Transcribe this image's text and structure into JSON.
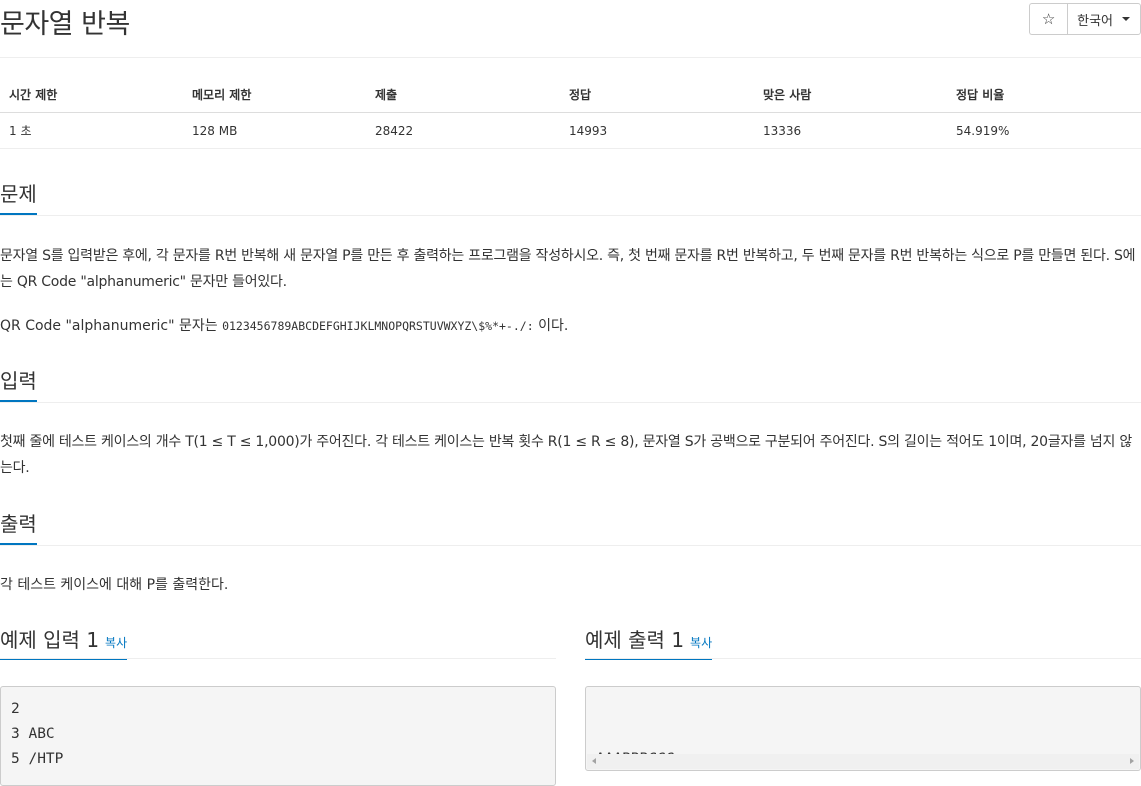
{
  "problem": {
    "title": "문자열 반복"
  },
  "top_actions": {
    "star": "☆",
    "language": "한국어"
  },
  "stats": {
    "headers": [
      "시간 제한",
      "메모리 제한",
      "제출",
      "정답",
      "맞은 사람",
      "정답 비율"
    ],
    "values": [
      "1 초",
      "128 MB",
      "28422",
      "14993",
      "13336",
      "54.919%"
    ]
  },
  "sections": {
    "problem": {
      "heading": "문제",
      "para1": "문자열 S를 입력받은 후에, 각 문자를 R번 반복해 새 문자열 P를 만든 후 출력하는 프로그램을 작성하시오. 즉, 첫 번째 문자를 R번 반복하고, 두 번째 문자를 R번 반복하는 식으로 P를 만들면 된다. S에는 QR Code \"alphanumeric\" 문자만 들어있다.",
      "para2_prefix": "QR Code \"alphanumeric\" 문자는 ",
      "para2_code": "0123456789ABCDEFGHIJKLMNOPQRSTUVWXYZ\\$%*+-./:",
      "para2_suffix": " 이다."
    },
    "input": {
      "heading": "입력",
      "text": "첫째 줄에 테스트 케이스의 개수 T(1 ≤ T ≤ 1,000)가 주어진다. 각 테스트 케이스는 반복 횟수 R(1 ≤ R ≤ 8), 문자열 S가 공백으로 구분되어 주어진다. S의 길이는 적어도 1이며, 20글자를 넘지 않는다."
    },
    "output": {
      "heading": "출력",
      "text": "각 테스트 케이스에 대해 P를 출력한다."
    }
  },
  "examples": {
    "input": {
      "heading": "예제 입력 1",
      "copy_label": "복사",
      "lines": "2\n3 ABC\n5 /HTP"
    },
    "output": {
      "heading": "예제 출력 1",
      "copy_label": "복사",
      "lines": "AAABBBCCC\n/////HHHHHTTTTTPPPPP"
    }
  }
}
